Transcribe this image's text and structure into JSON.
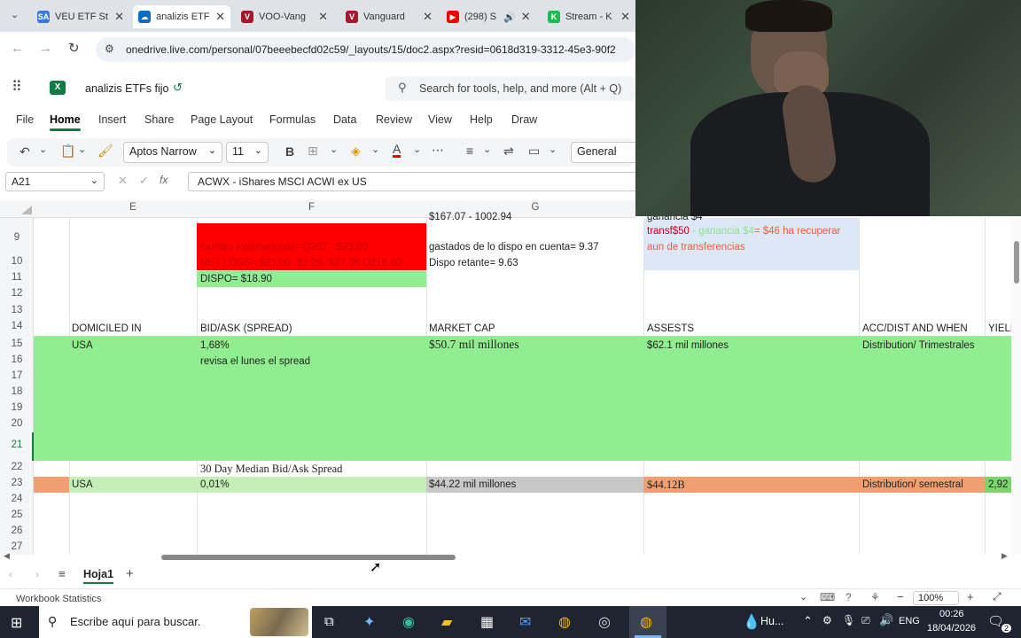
{
  "browser": {
    "tabs": [
      {
        "title": "VEU ETF St",
        "icon": "SA",
        "color": "#3a7bd5"
      },
      {
        "title": "analizis ETF",
        "icon": "cloud",
        "color": "#0f6cbd"
      },
      {
        "title": "VOO-Vang",
        "icon": "V",
        "color": "#a3192d"
      },
      {
        "title": "Vanguard",
        "icon": "V",
        "color": "#a3192d"
      },
      {
        "title": "(298) S",
        "icon": "yt",
        "color": "#e00"
      },
      {
        "title": "Stream - K",
        "icon": "K",
        "color": "#1db954"
      }
    ],
    "url": "onedrive.live.com/personal/07beeebecfd02c59/_layouts/15/doc2.aspx?resid=0618d319-3312-45e3-90f2"
  },
  "excel": {
    "filename": "analizis ETFs fijo",
    "search_placeholder": "Search for tools, help, and more (Alt + Q)",
    "ribbon_tabs": [
      "File",
      "Home",
      "Insert",
      "Share",
      "Page Layout",
      "Formulas",
      "Data",
      "Review",
      "View",
      "Help",
      "Draw"
    ],
    "font_name": "Aptos Narrow",
    "font_size": "11",
    "number_format": "General",
    "name_box": "A21",
    "formula": "ACWX - iShares MSCI ACWI ex US",
    "columns": [
      "E",
      "F",
      "G"
    ],
    "rows": [
      "9",
      "10",
      "11",
      "12",
      "13",
      "14",
      "15",
      "16",
      "17",
      "18",
      "19",
      "20",
      "21",
      "22",
      "23",
      "24",
      "25",
      "26",
      "27"
    ],
    "cells": {
      "g_top": "$167.07 - 1002.94",
      "h_top": "ganancia $4",
      "f9": "cambio internacional= Q287 - $23.00",
      "f10": "NET LOSS= $23.00- $2.29- $27.38 Q216.80",
      "g9": "gastados de lo dispo en cuenta= 9.37",
      "g10": "Dispo retante=  9.63",
      "h9a": "transf$50",
      "h9b": " - ganancia $4",
      "h9c": "= $46 ha recuperar",
      "h10": "aun de transferencias",
      "f11": "DISPO= $18.90",
      "e14": "DOMICILED IN",
      "f14": "BID/ASK (SPREAD)",
      "g14": "MARKET CAP",
      "h14": "ASSESTS",
      "i14": "ACC/DIST AND WHEN",
      "j14": "YIELD",
      "e15": "USA",
      "f15": "1,68%",
      "g15": "$50.7 mil millones",
      "h15": "$62.1 mil millones",
      "i15": "Distribution/ Trimestrales",
      "f16": "revisa el lunes el spread",
      "f22": "30 Day Median Bid/Ask Spread",
      "e23": "USA",
      "f23": "0,01%",
      "g23": "$44.22 mil millones",
      "h23": "$44.12B",
      "i23": "Distribution/ semestral",
      "j23": "2,92"
    },
    "sheet_tab": "Hoja1",
    "status_left": "Workbook Statistics",
    "zoom": "100%"
  },
  "taskbar": {
    "search_placeholder": "Escribe aquí para buscar.",
    "weather": "Hu...",
    "lang": "ENG",
    "time": "00:26",
    "date": "18/04/2026",
    "notifications": "2"
  },
  "colors": {
    "excel_green": "#117b44",
    "red_fill": "#ff0000",
    "green_fill": "#90ee90",
    "blue_fill": "#dde8f6",
    "grey_fill": "#c8c8c8",
    "salmon_fill": "#f0a070"
  }
}
